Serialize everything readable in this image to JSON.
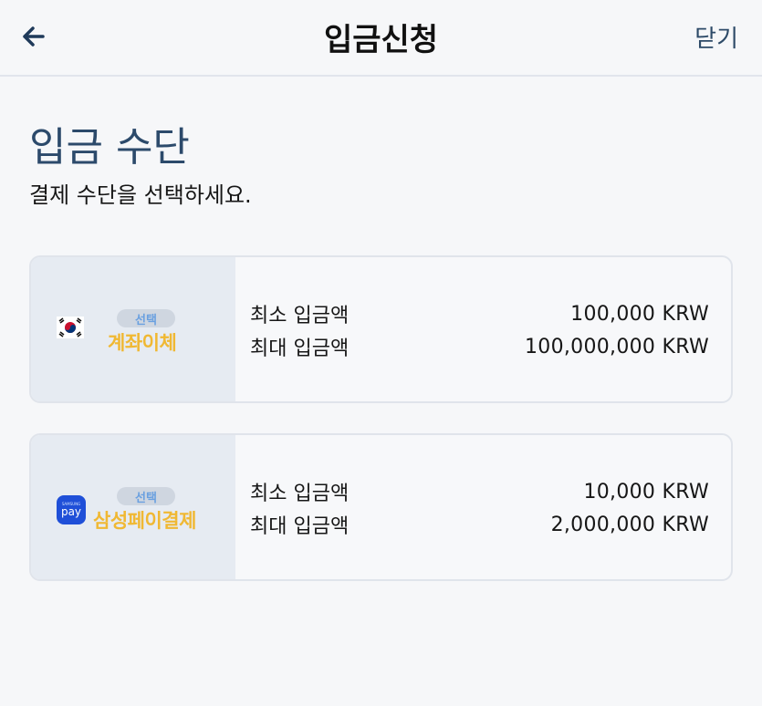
{
  "header": {
    "title": "입금신청",
    "close_label": "닫기"
  },
  "section": {
    "title": "입금 수단",
    "subtitle": "결제 수단을 선택하세요."
  },
  "methods": [
    {
      "badge": "선택",
      "name": "계좌이체",
      "icon": "korea-flag-icon",
      "min_label": "최소 입금액",
      "min_value": "100,000 KRW",
      "max_label": "최대 입금액",
      "max_value": "100,000,000 KRW"
    },
    {
      "badge": "선택",
      "name": "삼성페이결제",
      "icon": "samsung-pay-icon",
      "icon_text": "pay",
      "icon_brand_text": "SAMSUNG",
      "min_label": "최소 입금액",
      "min_value": "10,000 KRW",
      "max_label": "최대 입금액",
      "max_value": "2,000,000 KRW"
    }
  ],
  "colors": {
    "accent": "#2c4a6b",
    "badge_text": "#6aa0e0",
    "brand_yellow": "#f0b833",
    "pay_blue": "#1f4fd8"
  }
}
